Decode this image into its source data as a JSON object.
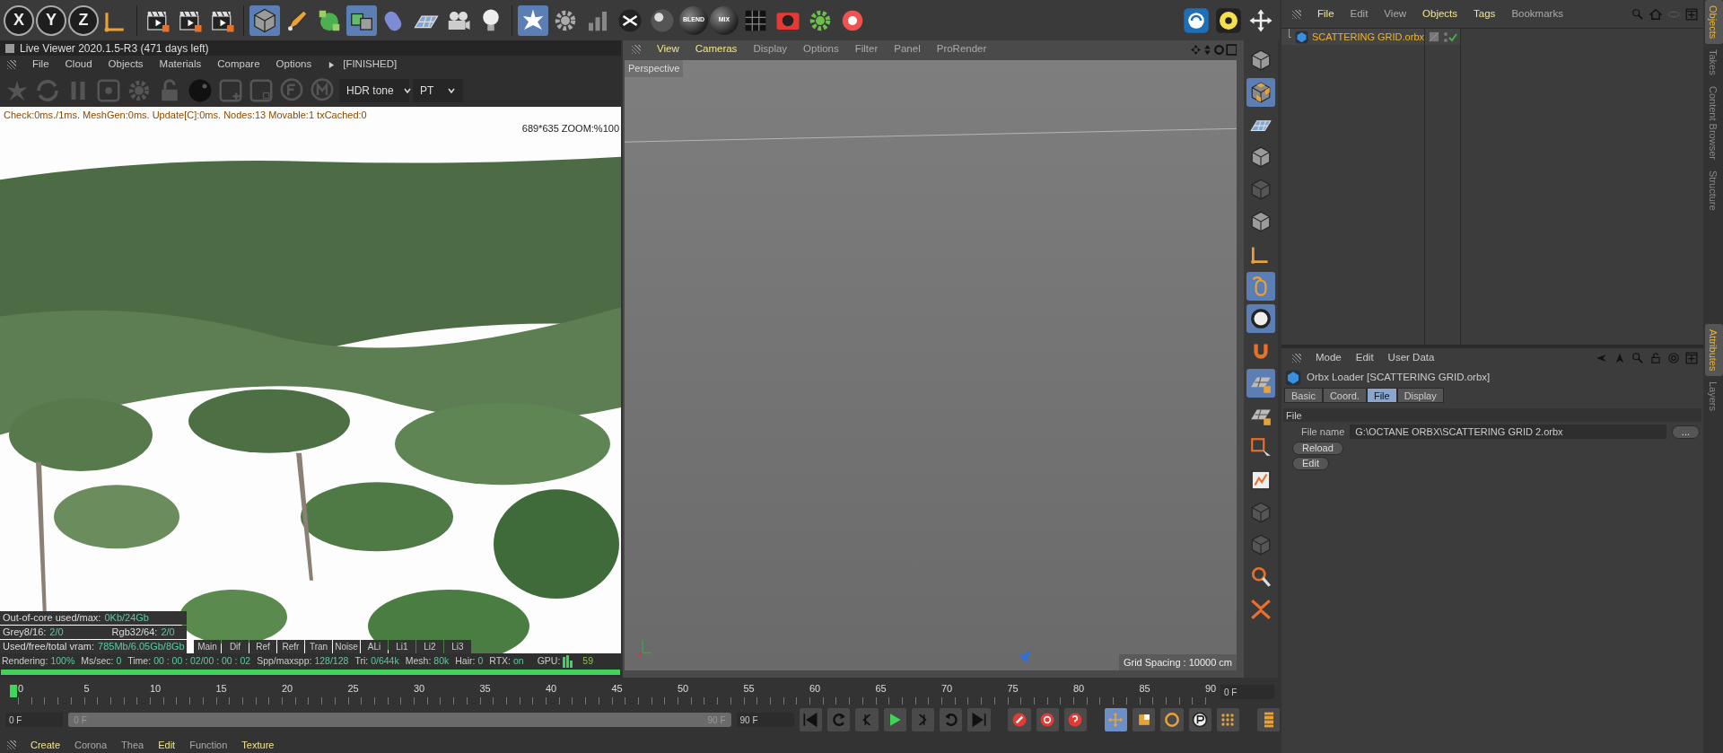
{
  "top_toolbar": {
    "axis_buttons": [
      {
        "label": "X"
      },
      {
        "label": "Y"
      },
      {
        "label": "Z"
      }
    ],
    "material_buttons": [
      {
        "label": "BLEND"
      },
      {
        "label": "MIX"
      }
    ],
    "tools": [
      {
        "active": false
      },
      {
        "active": false
      },
      {
        "active": false
      },
      {
        "active": false
      },
      {
        "active": true
      },
      {
        "active": false
      },
      {
        "active": false
      },
      {
        "active": true
      },
      {
        "active": false
      },
      {
        "active": false
      },
      {
        "active": false
      },
      {
        "active": false
      },
      {
        "active": true
      },
      {
        "active": false
      },
      {
        "active": false
      },
      {
        "active": false
      },
      {
        "active": false
      },
      {
        "active": false
      },
      {
        "active": false
      },
      {
        "active": false
      },
      {
        "active": false
      },
      {
        "active": false
      },
      {
        "active": false
      },
      {
        "active": false
      }
    ]
  },
  "live_viewer": {
    "title": "Live Viewer 2020.1.5-R3 (471 days left)",
    "menu": [
      "File",
      "Cloud",
      "Objects",
      "Materials",
      "Compare",
      "Options"
    ],
    "status": "[FINISHED]",
    "tone_select": "HDR tone",
    "kernel_select": "PT",
    "log": "Check:0ms./1ms. MeshGen:0ms. Update[C]:0ms. Nodes:13 Movable:1 txCached:0",
    "resolution": "689*635 ZOOM:%100",
    "stats": [
      [
        {
          "label": "Out-of-core used/max:",
          "value": "0Kb/24Gb"
        }
      ],
      [
        {
          "label": "Grey8/16:",
          "value": "2/0"
        },
        {
          "label": "Rgb32/64:",
          "value": "2/0"
        }
      ],
      [
        {
          "label": "Used/free/total vram:",
          "value": "785Mb/6.05Gb/8Gb"
        }
      ]
    ],
    "passes": [
      "Main",
      "Dif",
      "Ref",
      "Refr",
      "Tran",
      "Noise",
      "ALi",
      "Li1",
      "Li2",
      "Li3"
    ],
    "render_info": [
      {
        "label": "Rendering:",
        "value": "100%"
      },
      {
        "label": "Ms/sec:",
        "value": "0"
      },
      {
        "label": "Time:",
        "value": "00 : 00 : 02/00 : 00 : 02"
      },
      {
        "label": "Spp/maxspp:",
        "value": "128/128"
      },
      {
        "label": "Tri:",
        "value": "0/644k"
      },
      {
        "label": "Mesh:",
        "value": "80k"
      },
      {
        "label": "Hair:",
        "value": "0"
      },
      {
        "label": "RTX:",
        "value": "on"
      }
    ],
    "gpu": {
      "label": "GPU:",
      "value": "59"
    },
    "progress": {
      "level": 1
    }
  },
  "viewport": {
    "menu": [
      {
        "label": "View",
        "highlighted": true
      },
      {
        "label": "Cameras",
        "highlighted": true
      },
      {
        "label": "Display",
        "highlighted": false
      },
      {
        "label": "Options",
        "highlighted": false
      },
      {
        "label": "Filter",
        "highlighted": false
      },
      {
        "label": "Panel",
        "highlighted": false
      },
      {
        "label": "ProRender",
        "highlighted": false
      }
    ],
    "camera_label": "Perspective",
    "grid_spacing": "Grid Spacing : 10000 cm"
  },
  "viewport_tools": [
    {
      "active": false
    },
    {
      "active": true
    },
    {
      "active": false
    },
    {
      "active": false
    },
    {
      "active": false
    },
    {
      "active": false
    },
    {
      "active": false
    },
    {
      "active": true
    },
    {
      "active": true
    },
    {
      "active": false
    },
    {
      "active": true
    },
    {
      "active": false
    },
    {
      "active": false
    },
    {
      "active": false
    },
    {
      "active": false
    },
    {
      "active": false
    },
    {
      "active": false
    },
    {
      "active": false
    }
  ],
  "timeline": {
    "ticks": [
      "0",
      "5",
      "10",
      "15",
      "20",
      "25",
      "30",
      "35",
      "40",
      "45",
      "50",
      "55",
      "60",
      "65",
      "70",
      "75",
      "80",
      "85",
      "90"
    ],
    "current_frame": "0 F"
  },
  "transport": {
    "start_field": "0 F",
    "range": {
      "start": "0 F",
      "end": "90 F",
      "level": 1
    },
    "end_field": "90 F"
  },
  "bottom_menu": [
    {
      "label": "Create",
      "highlighted": true
    },
    {
      "label": "Corona",
      "highlighted": false
    },
    {
      "label": "Thea",
      "highlighted": false
    },
    {
      "label": "Edit",
      "highlighted": true
    },
    {
      "label": "Function",
      "highlighted": false
    },
    {
      "label": "Texture",
      "highlighted": true
    }
  ],
  "objects_panel": {
    "menu": [
      {
        "label": "File",
        "highlighted": true
      },
      {
        "label": "Edit",
        "highlighted": false
      },
      {
        "label": "View",
        "highlighted": false
      },
      {
        "label": "Objects",
        "highlighted": true
      },
      {
        "label": "Tags",
        "highlighted": true
      },
      {
        "label": "Bookmarks",
        "highlighted": false
      }
    ],
    "objects": [
      {
        "name": "SCATTERING GRID.orbx",
        "enabled": true
      }
    ]
  },
  "attributes_panel": {
    "menu": [
      "Mode",
      "Edit",
      "User Data"
    ],
    "title": "Orbx Loader [SCATTERING GRID.orbx]",
    "tabs": [
      {
        "label": "Basic",
        "selected": false
      },
      {
        "label": "Coord.",
        "selected": false
      },
      {
        "label": "File",
        "selected": true
      },
      {
        "label": "Display",
        "selected": false
      }
    ],
    "section": "File",
    "file_name_label": "File name",
    "file_name": "G:\\OCTANE ORBX\\SCATTERING GRID 2.orbx",
    "browse": "...",
    "buttons": [
      "Reload",
      "Edit"
    ]
  },
  "side_tabs_top": [
    {
      "label": "Objects",
      "selected": true
    },
    {
      "label": "Takes",
      "selected": false
    },
    {
      "label": "Content Browser",
      "selected": false
    },
    {
      "label": "Structure",
      "selected": false
    }
  ],
  "side_tabs_bottom": [
    {
      "label": "Attributes",
      "selected": true
    },
    {
      "label": "Layers",
      "selected": false
    }
  ]
}
